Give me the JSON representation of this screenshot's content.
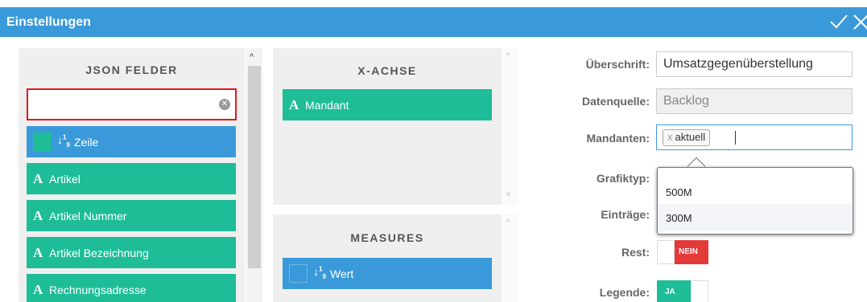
{
  "dialog": {
    "title": "Einstellungen",
    "ok_icon": "check-icon",
    "close_icon": "close-icon"
  },
  "json_fields": {
    "heading": "JSON FELDER",
    "search": {
      "value": "",
      "placeholder": ""
    },
    "items": [
      {
        "label": "Zeile",
        "type": "number"
      },
      {
        "label": "Artikel",
        "type": "text"
      },
      {
        "label": "Artikel Nummer",
        "type": "text"
      },
      {
        "label": "Artikel Bezeichnung",
        "type": "text"
      },
      {
        "label": "Rechnungsadresse",
        "type": "text"
      }
    ]
  },
  "x_axis": {
    "heading": "X-ACHSE",
    "items": [
      {
        "label": "Mandant",
        "type": "text"
      }
    ]
  },
  "measures": {
    "heading": "MEASURES",
    "items": [
      {
        "label": "Wert",
        "type": "number"
      }
    ]
  },
  "form": {
    "heading_label": "Überschrift:",
    "heading_value": "Umsatzgegenüberstellung",
    "source_label": "Datenquelle:",
    "source_value": "Backlog",
    "clients_label": "Mandanten:",
    "clients_tag_remove": "x",
    "clients_tag": "aktuell",
    "chart_type_label": "Grafiktyp:",
    "entries_label": "Einträge:",
    "rest_label": "Rest:",
    "rest_value": "NEIN",
    "legend_label": "Legende:",
    "legend_value": "JA"
  },
  "dropdown": {
    "options": [
      "500M",
      "300M"
    ],
    "highlighted": "300M"
  },
  "colors": {
    "accent": "#3a9ad9",
    "teal": "#1ebd98",
    "danger": "#e53a3a",
    "search_border": "#e0191c"
  }
}
